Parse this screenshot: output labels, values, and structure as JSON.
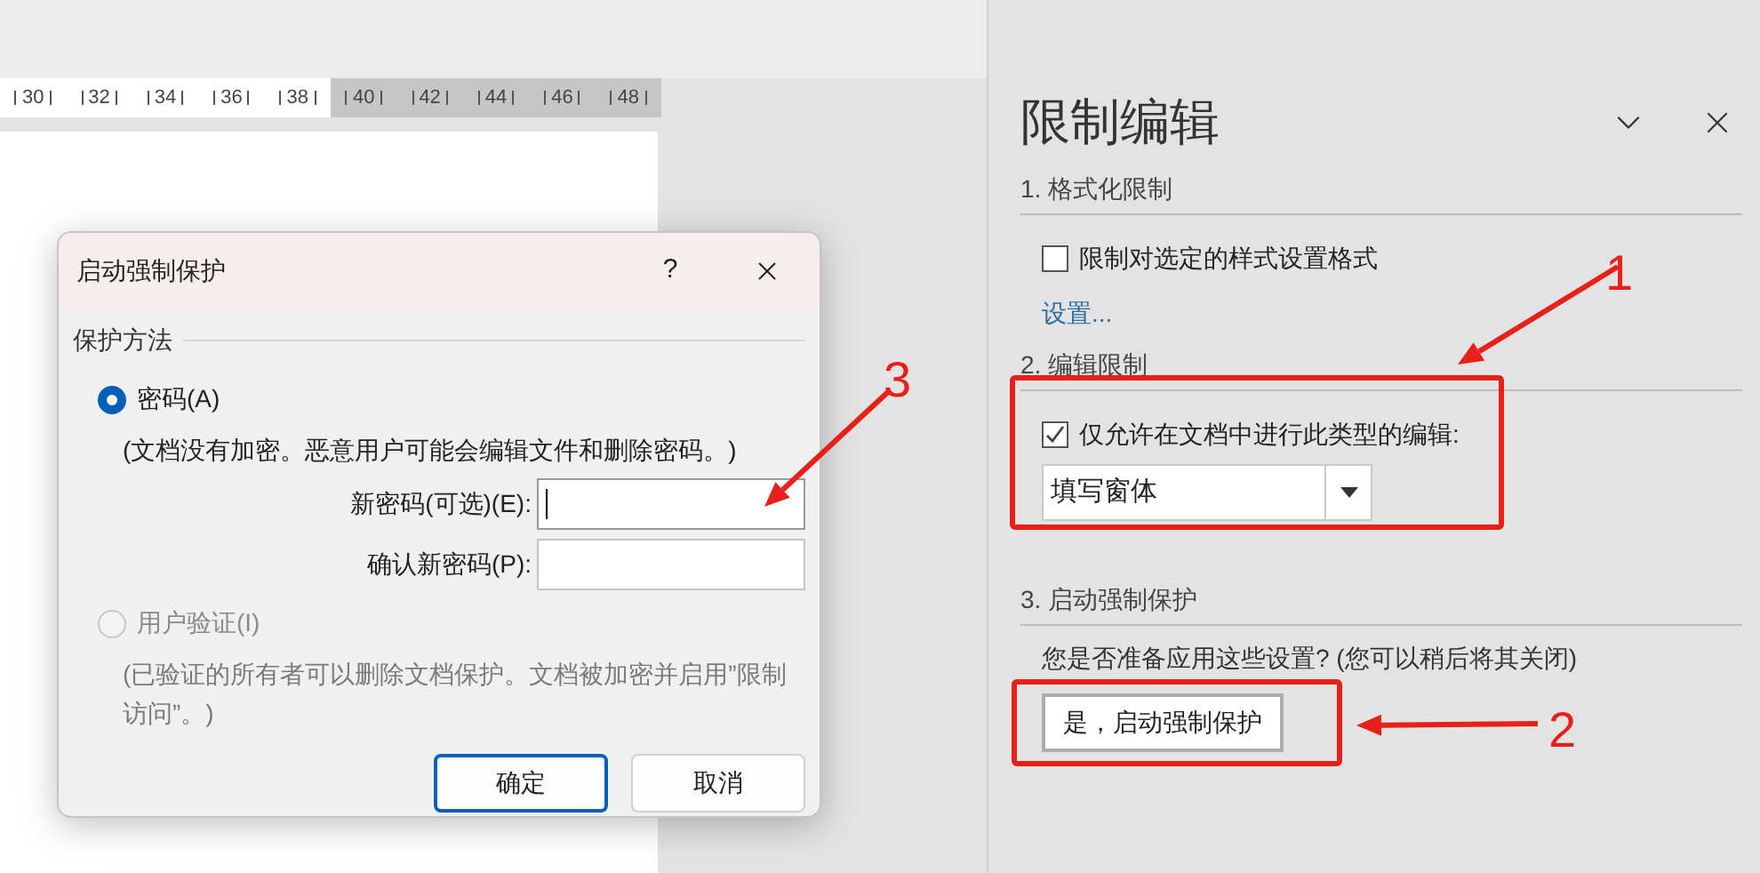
{
  "document": {
    "ruler": [
      {
        "label": "30",
        "margin": false
      },
      {
        "label": "32",
        "margin": false
      },
      {
        "label": "34",
        "margin": false
      },
      {
        "label": "36",
        "margin": false
      },
      {
        "label": "38",
        "margin": false
      },
      {
        "label": "40",
        "margin": true
      },
      {
        "label": "42",
        "margin": true
      },
      {
        "label": "44",
        "margin": true
      },
      {
        "label": "46",
        "margin": true
      },
      {
        "label": "48",
        "margin": true
      }
    ]
  },
  "panel": {
    "title": "限制编辑",
    "sections": [
      {
        "heading": "1. 格式化限制",
        "checkbox": {
          "label": "限制对选定的样式设置格式",
          "checked": false
        },
        "link": "设置..."
      },
      {
        "heading": "2. 编辑限制",
        "checkbox": {
          "label": "仅允许在文档中进行此类型的编辑:",
          "checked": true
        },
        "dropdown": {
          "value": "填写窗体"
        }
      },
      {
        "heading": "3. 启动强制保护",
        "prompt": "您是否准备应用这些设置? (您可以稍后将其关闭)",
        "button": "是，启动强制保护"
      }
    ]
  },
  "dialog": {
    "title": "启动强制保护",
    "help": "?",
    "group": "保护方法",
    "options": [
      {
        "label": "密码(A)",
        "selected": true,
        "disabled": false,
        "note": "(文档没有加密。恶意用户可能会编辑文件和删除密码。)",
        "fields": [
          {
            "label": "新密码(可选)(E):",
            "focused": true
          },
          {
            "label": "确认新密码(P):",
            "focused": false
          }
        ]
      },
      {
        "label": "用户验证(I)",
        "selected": false,
        "disabled": true,
        "note": "(已验证的所有者可以删除文档保护。文档被加密并启用”限制访问”。)"
      }
    ],
    "buttons": [
      {
        "label": "确定",
        "default": true
      },
      {
        "label": "取消",
        "default": false
      }
    ]
  },
  "annotations": [
    {
      "number": "1"
    },
    {
      "number": "2"
    },
    {
      "number": "3"
    }
  ]
}
